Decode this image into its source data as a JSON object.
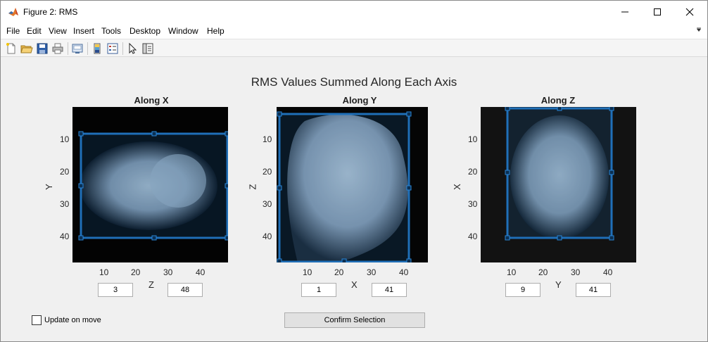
{
  "window": {
    "title": "Figure 2: RMS"
  },
  "menu": [
    "File",
    "Edit",
    "View",
    "Insert",
    "Tools",
    "Desktop",
    "Window",
    "Help"
  ],
  "figure": {
    "title": "RMS Values Summed Along Each Axis",
    "panels": [
      {
        "title": "Along X",
        "xlabel": "Z",
        "ylabel": "Y",
        "xticks": [
          "10",
          "20",
          "30",
          "40"
        ],
        "yticks": [
          "10",
          "20",
          "30",
          "40"
        ],
        "min_value": "3",
        "max_value": "48"
      },
      {
        "title": "Along Y",
        "xlabel": "X",
        "ylabel": "Z",
        "xticks": [
          "10",
          "20",
          "30",
          "40"
        ],
        "yticks": [
          "10",
          "20",
          "30",
          "40"
        ],
        "min_value": "1",
        "max_value": "41"
      },
      {
        "title": "Along Z",
        "xlabel": "Y",
        "ylabel": "X",
        "xticks": [
          "10",
          "20",
          "30",
          "40"
        ],
        "yticks": [
          "10",
          "20",
          "30",
          "40"
        ],
        "min_value": "9",
        "max_value": "41"
      }
    ]
  },
  "controls": {
    "update_on_move_label": "Update on move",
    "update_on_move_checked": false,
    "confirm_label": "Confirm Selection"
  },
  "colors": {
    "selection": "#1f6fb8",
    "background": "#f0f0f0"
  }
}
